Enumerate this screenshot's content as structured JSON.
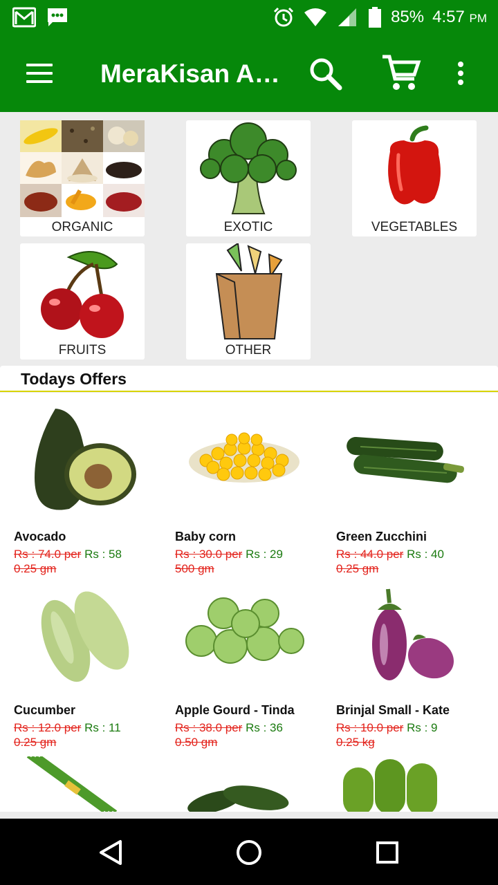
{
  "status_bar": {
    "battery": "85%",
    "time": "4:57",
    "ampm": "PM",
    "icons": [
      "gmail-icon",
      "message-icon",
      "alarm-icon",
      "wifi-icon",
      "signal-icon",
      "battery-icon"
    ]
  },
  "toolbar": {
    "title": "MeraKisan A…",
    "icons": [
      "menu-icon",
      "search-icon",
      "cart-icon",
      "overflow-icon"
    ]
  },
  "categories": [
    {
      "label": "ORGANIC",
      "icon": "organic-collage"
    },
    {
      "label": "EXOTIC",
      "icon": "broccoli"
    },
    {
      "label": "VEGETABLES",
      "icon": "bell-pepper"
    },
    {
      "label": "FRUITS",
      "icon": "cherries"
    },
    {
      "label": "OTHER",
      "icon": "grocery-bag"
    }
  ],
  "offers": {
    "heading": "Todays Offers",
    "items": [
      {
        "name": "Avocado",
        "old": "Rs : 74.0 per",
        "new": "Rs : 58",
        "unit": "0.25 gm",
        "icon": "avocado"
      },
      {
        "name": "Baby corn",
        "old": "Rs : 30.0 per",
        "new": "Rs : 29",
        "unit": "500 gm",
        "icon": "corn"
      },
      {
        "name": "Green Zucchini",
        "old": "Rs : 44.0 per",
        "new": "Rs : 40",
        "unit": "0.25 gm",
        "icon": "zucchini"
      },
      {
        "name": "Cucumber",
        "old": "Rs : 12.0 per",
        "new": "Rs : 11",
        "unit": "0.25 gm",
        "icon": "cucumber"
      },
      {
        "name": "Apple Gourd - Tinda",
        "old": "Rs : 38.0 per",
        "new": "Rs : 36",
        "unit": "0.50 gm",
        "icon": "tinda"
      },
      {
        "name": "Brinjal Small - Kate",
        "old": "Rs : 10.0 per",
        "new": "Rs : 9",
        "unit": "0.25 kg",
        "icon": "brinjal"
      }
    ]
  },
  "nav_bar": {
    "icons": [
      "back-icon",
      "home-icon",
      "recents-icon"
    ]
  },
  "colors": {
    "primary": "#06880a",
    "old_price": "#e3231c",
    "new_price": "#1a7a0f",
    "offers_underline": "#d8d400"
  }
}
